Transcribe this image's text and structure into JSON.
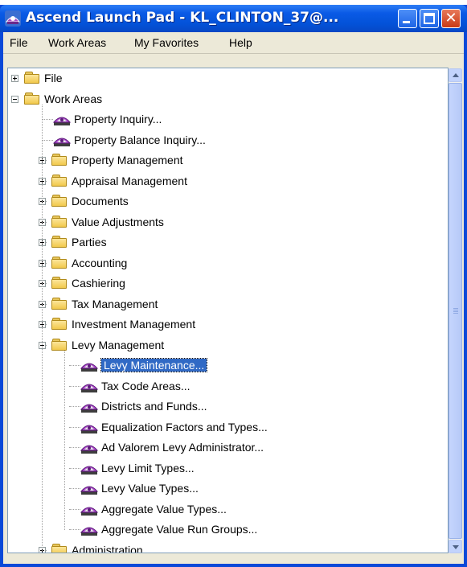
{
  "window": {
    "title": "Ascend  Launch Pad - KL_CLINTON_37@...",
    "close_glyph": "✕"
  },
  "menu": [
    "File",
    "Work Areas",
    "My Favorites",
    "Help"
  ],
  "tree": [
    {
      "label": "File",
      "type": "folder",
      "level": 0,
      "expander": "plus"
    },
    {
      "label": "Work Areas",
      "type": "folder",
      "level": 0,
      "expander": "minus"
    },
    {
      "label": "Property Inquiry...",
      "type": "launch",
      "level": 1
    },
    {
      "label": "Property Balance Inquiry...",
      "type": "launch",
      "level": 1
    },
    {
      "label": "Property Management",
      "type": "folder",
      "level": 1,
      "expander": "plus"
    },
    {
      "label": "Appraisal Management",
      "type": "folder",
      "level": 1,
      "expander": "plus"
    },
    {
      "label": "Documents",
      "type": "folder",
      "level": 1,
      "expander": "plus"
    },
    {
      "label": "Value Adjustments",
      "type": "folder",
      "level": 1,
      "expander": "plus"
    },
    {
      "label": "Parties",
      "type": "folder",
      "level": 1,
      "expander": "plus"
    },
    {
      "label": "Accounting",
      "type": "folder",
      "level": 1,
      "expander": "plus"
    },
    {
      "label": "Cashiering",
      "type": "folder",
      "level": 1,
      "expander": "plus"
    },
    {
      "label": "Tax Management",
      "type": "folder",
      "level": 1,
      "expander": "plus"
    },
    {
      "label": "Investment Management",
      "type": "folder",
      "level": 1,
      "expander": "plus"
    },
    {
      "label": "Levy Management",
      "type": "folder",
      "level": 1,
      "expander": "minus"
    },
    {
      "label": "Levy Maintenance...",
      "type": "launch",
      "level": 2,
      "selected": true
    },
    {
      "label": "Tax Code Areas...",
      "type": "launch",
      "level": 2
    },
    {
      "label": "Districts and Funds...",
      "type": "launch",
      "level": 2
    },
    {
      "label": "Equalization Factors and Types...",
      "type": "launch",
      "level": 2
    },
    {
      "label": "Ad Valorem Levy Administrator...",
      "type": "launch",
      "level": 2
    },
    {
      "label": "Levy Limit Types...",
      "type": "launch",
      "level": 2
    },
    {
      "label": "Levy Value Types...",
      "type": "launch",
      "level": 2
    },
    {
      "label": "Aggregate Value Types...",
      "type": "launch",
      "level": 2
    },
    {
      "label": "Aggregate Value Run Groups...",
      "type": "launch",
      "level": 2
    },
    {
      "label": "Administration",
      "type": "folder",
      "level": 1,
      "expander": "plus"
    }
  ],
  "colors": {
    "titlebar": "#0a5ae6",
    "selection": "#316ac5",
    "menubar": "#ece9d8"
  },
  "icons": {
    "app": "ascend-launchpad-icon",
    "folder": "folder-icon",
    "launch": "launch-item-icon"
  }
}
